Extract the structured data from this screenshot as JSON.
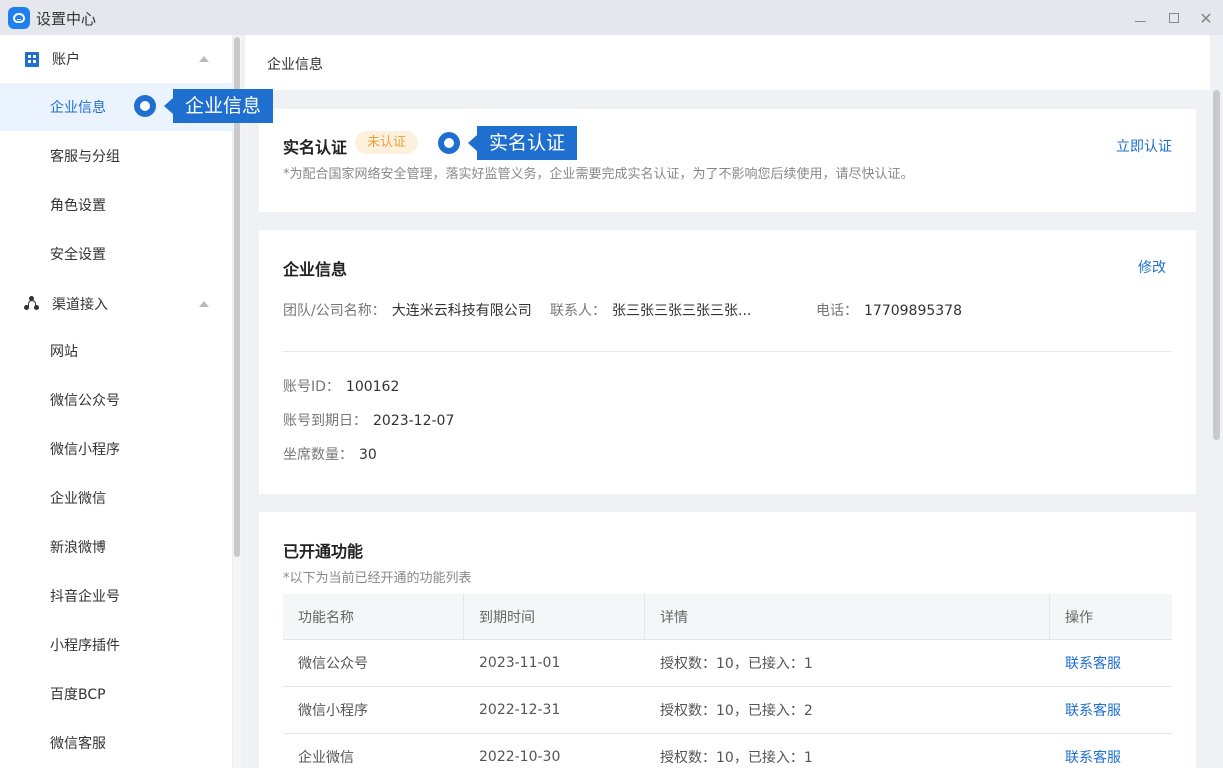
{
  "window": {
    "title": "设置中心",
    "icons": {
      "logo": "chat-face-icon",
      "minimize": "minimize-icon",
      "maximize": "maximize-icon",
      "close": "close-icon"
    }
  },
  "sidebar": {
    "groups": [
      {
        "label": "账户",
        "icon": "building-icon"
      },
      {
        "label": "渠道接入",
        "icon": "network-icon"
      }
    ],
    "account_items": [
      {
        "label": "企业信息",
        "active": true
      },
      {
        "label": "客服与分组"
      },
      {
        "label": "角色设置"
      },
      {
        "label": "安全设置"
      }
    ],
    "channel_items": [
      {
        "label": "网站"
      },
      {
        "label": "微信公众号"
      },
      {
        "label": "微信小程序"
      },
      {
        "label": "企业微信"
      },
      {
        "label": "新浪微博"
      },
      {
        "label": "抖音企业号"
      },
      {
        "label": "小程序插件"
      },
      {
        "label": "百度BCP"
      },
      {
        "label": "微信客服"
      }
    ]
  },
  "header": {
    "title": "企业信息"
  },
  "verify": {
    "title": "实名认证",
    "badge": "未认证",
    "action": "立即认证",
    "note": "*为配合国家网络安全管理，落实好监管义务，企业需要完成实名认证，为了不影响您后续使用，请尽快认证。"
  },
  "company": {
    "title": "企业信息",
    "edit": "修改",
    "name_label": "团队/公司名称：",
    "name_value": "大连米云科技有限公司",
    "contact_label": "联系人：",
    "contact_value": "张三张三张三张三张...",
    "phone_label": "电话：",
    "phone_value": "17709895378",
    "account_id_label": "账号ID：",
    "account_id_value": "100162",
    "expire_label": "账号到期日：",
    "expire_value": "2023-12-07",
    "seats_label": "坐席数量：",
    "seats_value": "30"
  },
  "features": {
    "title": "已开通功能",
    "note": "*以下为当前已经开通的功能列表",
    "columns": [
      "功能名称",
      "到期时间",
      "详情",
      "操作"
    ],
    "rows": [
      {
        "name": "微信公众号",
        "expire": "2023-11-01",
        "detail": "授权数：10，已接入：1",
        "action": "联系客服"
      },
      {
        "name": "微信小程序",
        "expire": "2022-12-31",
        "detail": "授权数：10，已接入：2",
        "action": "联系客服"
      },
      {
        "name": "企业微信",
        "expire": "2022-10-30",
        "detail": "授权数：10，已接入：1",
        "action": "联系客服"
      }
    ]
  },
  "callouts": [
    {
      "text": "企业信息"
    },
    {
      "text": "实名认证"
    }
  ],
  "colors": {
    "accent": "#1f6fd1",
    "badge_bg": "#fdf1dd",
    "badge_text": "#e6a23c",
    "active_bg": "#ebf3fe"
  }
}
